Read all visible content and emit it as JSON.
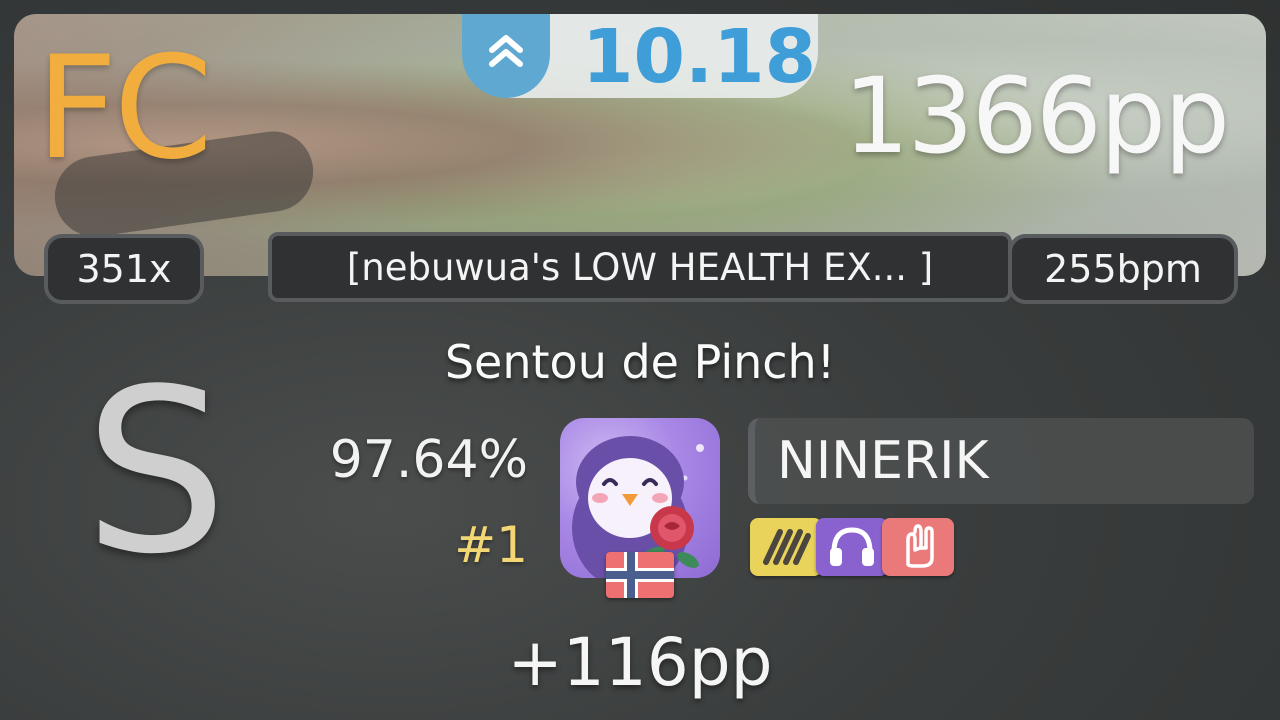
{
  "banner": {
    "grade_label": "FC",
    "star_rating": "10.18",
    "star_icon": "double-chevron-up-icon",
    "total_pp": "1366pp"
  },
  "stats": {
    "combo": "351x",
    "difficulty": "[nebuwua's LOW HEALTH EX... ]",
    "bpm": "255bpm"
  },
  "song_title": "Sentou de Pinch!",
  "rank": "S",
  "accuracy": "97.64%",
  "placement": "#1",
  "player": {
    "name": "NINERIK",
    "avatar": "penguin-avatar",
    "country_flag": "norway-flag-icon"
  },
  "mods": [
    {
      "icon": "hard-rock-icon",
      "color": "#e9d35a"
    },
    {
      "icon": "headphones-icon",
      "color": "#8a62cf"
    },
    {
      "icon": "rock-hand-icon",
      "color": "#e97a79"
    }
  ],
  "pp_gain": "+116pp",
  "colors": {
    "fc": "#f2ad3f",
    "star_rating": "#3f9ed8",
    "placement": "#f3d775"
  }
}
